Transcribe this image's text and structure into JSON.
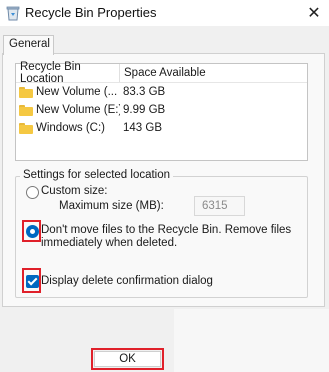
{
  "window": {
    "title": "Recycle Bin Properties",
    "icon": "recycle-bin-icon",
    "close_glyph": "✕"
  },
  "tabs": [
    {
      "label": "General"
    }
  ],
  "locations": {
    "headers": {
      "location": "Recycle Bin Location",
      "space": "Space Available"
    },
    "rows": [
      {
        "location": "New Volume (...",
        "space": "83.3 GB",
        "icon": "folder-icon"
      },
      {
        "location": "New Volume (E:)",
        "space": "9.99 GB",
        "icon": "folder-icon"
      },
      {
        "location": "Windows (C:)",
        "space": "143 GB",
        "icon": "folder-icon"
      }
    ]
  },
  "settings": {
    "group_label": "Settings for selected location",
    "custom_size_label": "Custom size:",
    "max_size_label": "Maximum size (MB):",
    "max_size_value": "6315",
    "dont_move_label": "Don't move files to the Recycle Bin. Remove files immediately when deleted.",
    "dont_move_selected": true,
    "confirm_label": "Display delete confirmation dialog",
    "confirm_checked": true
  },
  "buttons": {
    "ok_label": "OK"
  },
  "colors": {
    "accent": "#0067c0",
    "highlight": "#e0202a",
    "folder": "#f5c842"
  }
}
